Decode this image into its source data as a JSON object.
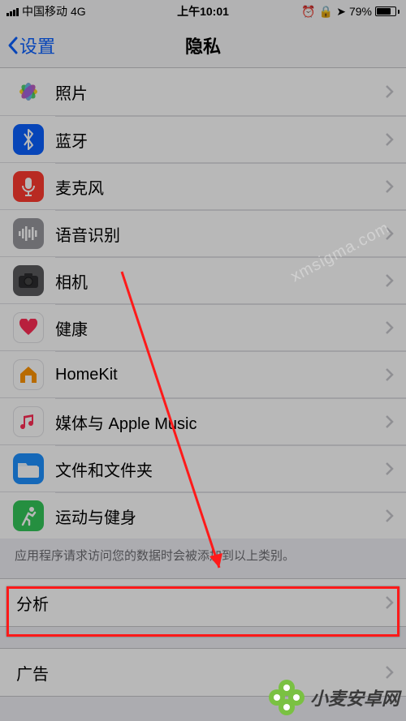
{
  "status": {
    "carrier": "中国移动",
    "network": "4G",
    "time": "上午10:01",
    "battery_pct": "79%",
    "icons": [
      "alarm",
      "lock-rotation",
      "location"
    ]
  },
  "nav": {
    "back_label": "设置",
    "title": "隐私"
  },
  "privacy_rows": [
    {
      "id": "photos",
      "label": "照片"
    },
    {
      "id": "bluetooth",
      "label": "蓝牙"
    },
    {
      "id": "microphone",
      "label": "麦克风"
    },
    {
      "id": "speech",
      "label": "语音识别"
    },
    {
      "id": "camera",
      "label": "相机"
    },
    {
      "id": "health",
      "label": "健康"
    },
    {
      "id": "homekit",
      "label": "HomeKit"
    },
    {
      "id": "media",
      "label": "媒体与 Apple Music"
    },
    {
      "id": "files",
      "label": "文件和文件夹"
    },
    {
      "id": "activity",
      "label": "运动与健身"
    }
  ],
  "section_note": "应用程序请求访问您的数据时会被添加到以上类别。",
  "group2": [
    {
      "id": "analytics",
      "label": "分析"
    },
    {
      "id": "ads",
      "label": "广告"
    }
  ],
  "watermark": {
    "diag": "xmsigma.com",
    "logo_text": "小麦安卓网"
  },
  "annotation": {
    "highlight_target": "analytics"
  }
}
